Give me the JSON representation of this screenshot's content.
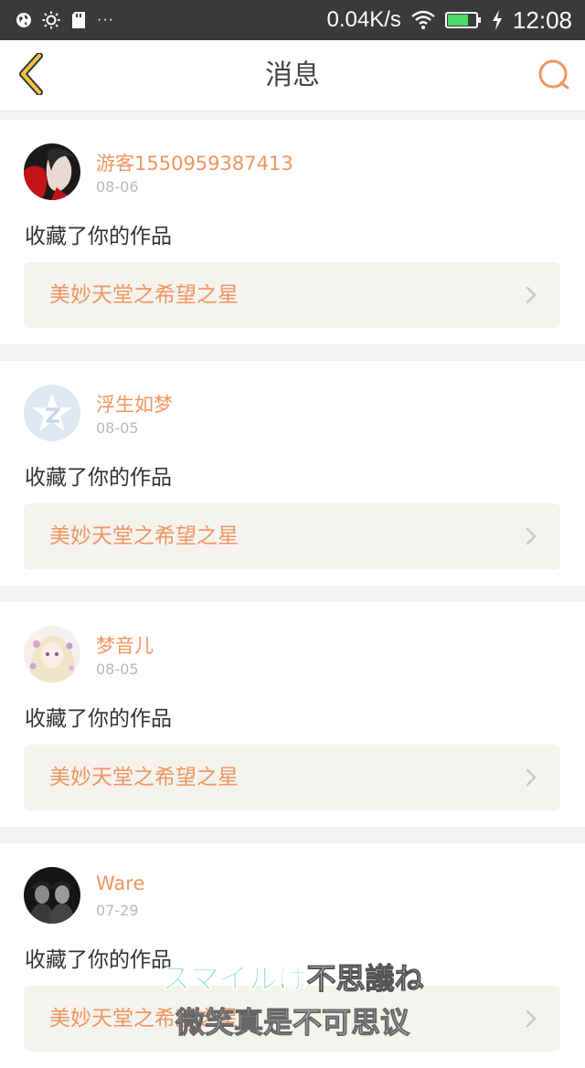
{
  "status_bar": {
    "speed": "0.04K/s",
    "time": "12:08",
    "dots": "···",
    "icons": [
      "globe-icon",
      "brightness-icon",
      "sd-card-icon",
      "wifi-icon",
      "battery-icon",
      "charging-icon"
    ]
  },
  "nav": {
    "title": "消息",
    "back_icon": "chevron-left-icon",
    "search_icon": "search-icon"
  },
  "messages": [
    {
      "user": "游客1550959387413",
      "date": "08-06",
      "text": "收藏了你的作品",
      "work": "美妙天堂之希望之星"
    },
    {
      "user": "浮生如梦",
      "date": "08-05",
      "text": "收藏了你的作品",
      "work": "美妙天堂之希望之星"
    },
    {
      "user": "梦音儿",
      "date": "08-05",
      "text": "收藏了你的作品",
      "work": "美妙天堂之希望之星"
    },
    {
      "user": "Ware",
      "date": "07-29",
      "text": "收藏了你的作品",
      "work": "美妙天堂之希望之星"
    }
  ],
  "subtitle": {
    "line1_green": "スマイルは",
    "line1_white": "不思議ね",
    "line2": "微笑真是不可思议"
  },
  "colors": {
    "accent": "#ef9560",
    "status_bar": "#3a3a3a",
    "link_bg": "#f4f3ee",
    "subtitle_green": "#2fd08a"
  }
}
